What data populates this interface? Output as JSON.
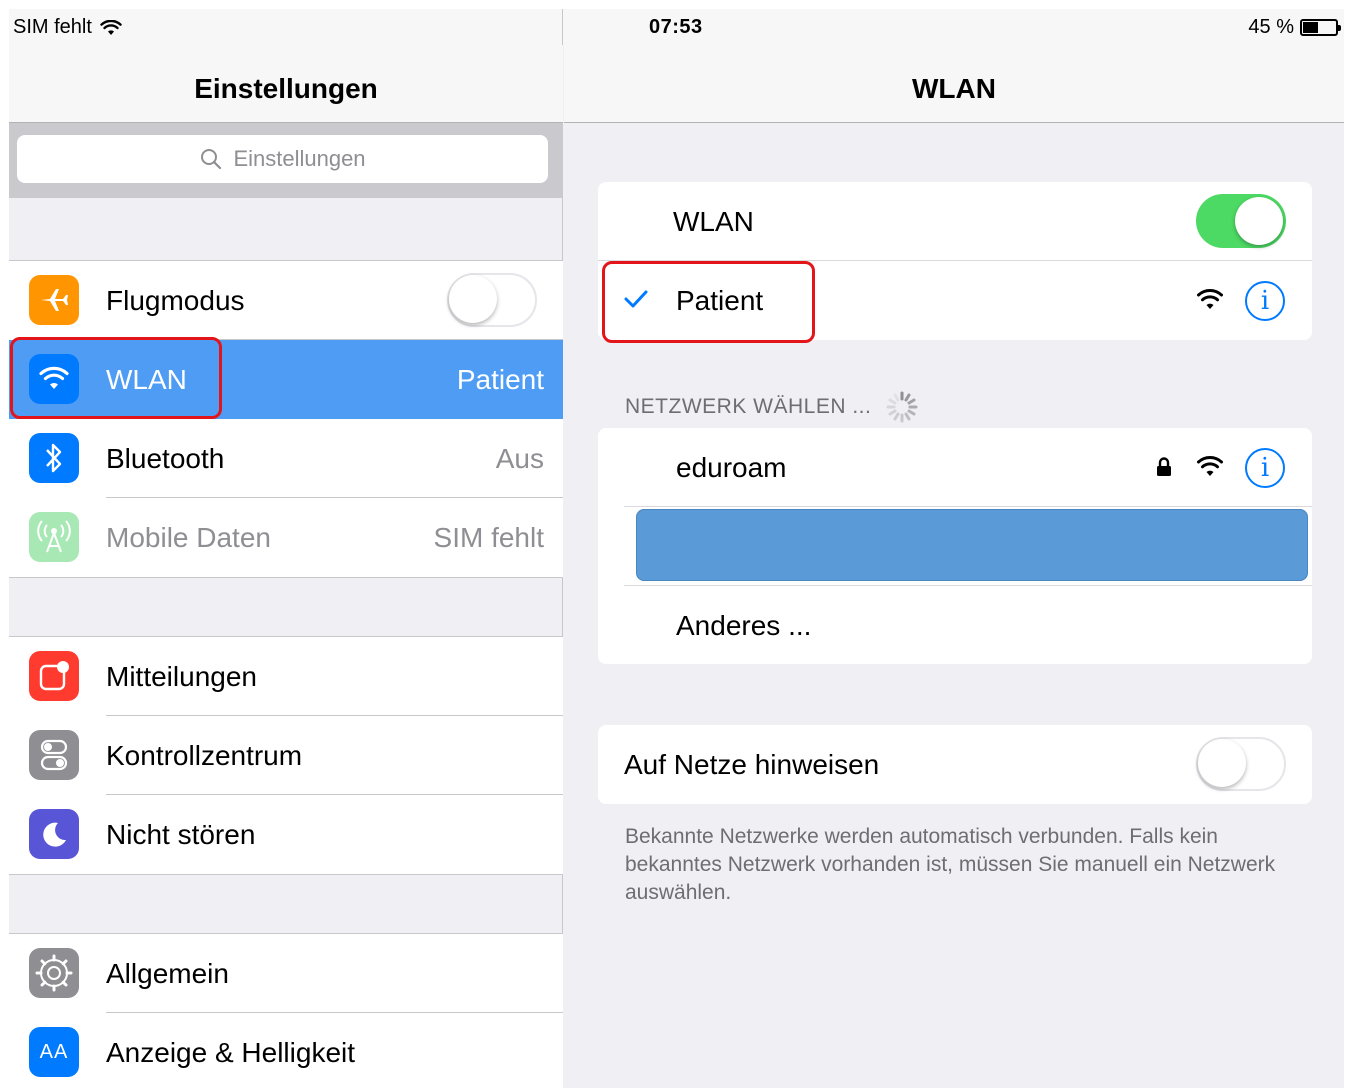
{
  "status_bar": {
    "carrier": "SIM fehlt",
    "time": "07:53",
    "battery": "45 %"
  },
  "left": {
    "title": "Einstellungen",
    "search_placeholder": "Einstellungen",
    "groups": [
      {
        "items": [
          {
            "label": "Flugmodus",
            "icon": "airplane-icon",
            "color": "#ff9500",
            "toggle": "off"
          },
          {
            "label": "WLAN",
            "value": "Patient",
            "icon": "wifi-icon",
            "color": "#007aff",
            "selected": true
          },
          {
            "label": "Bluetooth",
            "value": "Aus",
            "icon": "bluetooth-icon",
            "color": "#007aff"
          },
          {
            "label": "Mobile Daten",
            "value": "SIM fehlt",
            "icon": "cellular-icon",
            "color": "#4cd964",
            "disabled": true
          }
        ]
      },
      {
        "items": [
          {
            "label": "Mitteilungen",
            "icon": "notifications-icon",
            "color": "#ff3b30"
          },
          {
            "label": "Kontrollzentrum",
            "icon": "control-center-icon",
            "color": "#8e8e93"
          },
          {
            "label": "Nicht stören",
            "icon": "moon-icon",
            "color": "#5856d6"
          }
        ]
      },
      {
        "items": [
          {
            "label": "Allgemein",
            "icon": "gear-icon",
            "color": "#8e8e93"
          },
          {
            "label": "Anzeige & Helligkeit",
            "icon": "display-icon",
            "color": "#007aff",
            "icon_text": "AA"
          }
        ]
      }
    ]
  },
  "right": {
    "title": "WLAN",
    "wlan_label": "WLAN",
    "wlan_toggle": "on",
    "connected_network": "Patient",
    "section_header": "NETZWERK WÄHLEN ...",
    "networks": [
      {
        "name": "eduroam",
        "locked": true
      }
    ],
    "other_label": "Anderes ...",
    "ask_join_label": "Auf Netze hinweisen",
    "ask_join_toggle": "off",
    "footer": "Bekannte Netzwerke werden automatisch verbunden. Falls kein bekanntes Netzwerk vorhanden ist, müssen Sie manuell ein Netzwerk auswählen."
  },
  "colors": {
    "accent": "#007aff",
    "selected_row": "#4f9cf4",
    "toggle_on": "#4cd964",
    "annotation": "#e4151a"
  }
}
